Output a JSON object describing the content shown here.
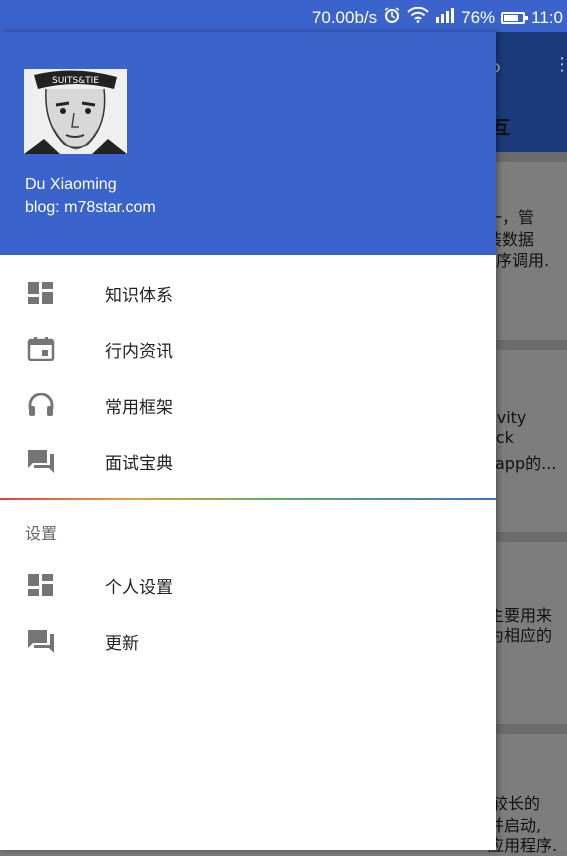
{
  "status_bar": {
    "network_speed": "70.00b/s",
    "battery_percent": "76%",
    "battery_level": 0.76,
    "time": "11:0",
    "icons": [
      "alarm-icon",
      "wifi-icon",
      "signal-icon",
      "battery-icon"
    ]
  },
  "background_app": {
    "toolbar_title": "互",
    "cards": [
      {
        "lines": [
          "一，管",
          "装数据",
          "程序调用."
        ]
      },
      {
        "lines": [
          "tivity",
          "ack",
          "kapp的..."
        ]
      },
      {
        "lines": [
          "主要用来",
          "为相应的"
        ]
      },
      {
        "lines": [
          "较长的",
          "并启动,",
          "应用程序."
        ]
      }
    ]
  },
  "drawer": {
    "header": {
      "avatar_alt": "avatar",
      "name": "Du Xiaoming",
      "blog": "blog: m78star.com",
      "background_color": "#3b63cc"
    },
    "primary_items": [
      {
        "label": "知识体系",
        "icon": "dashboard-icon"
      },
      {
        "label": "行内资讯",
        "icon": "calendar-icon"
      },
      {
        "label": "常用框架",
        "icon": "headset-icon"
      },
      {
        "label": "面试宝典",
        "icon": "forum-icon"
      }
    ],
    "section_title": "设置",
    "settings_items": [
      {
        "label": "个人设置",
        "icon": "dashboard-icon"
      },
      {
        "label": "更新",
        "icon": "forum-icon"
      }
    ]
  }
}
